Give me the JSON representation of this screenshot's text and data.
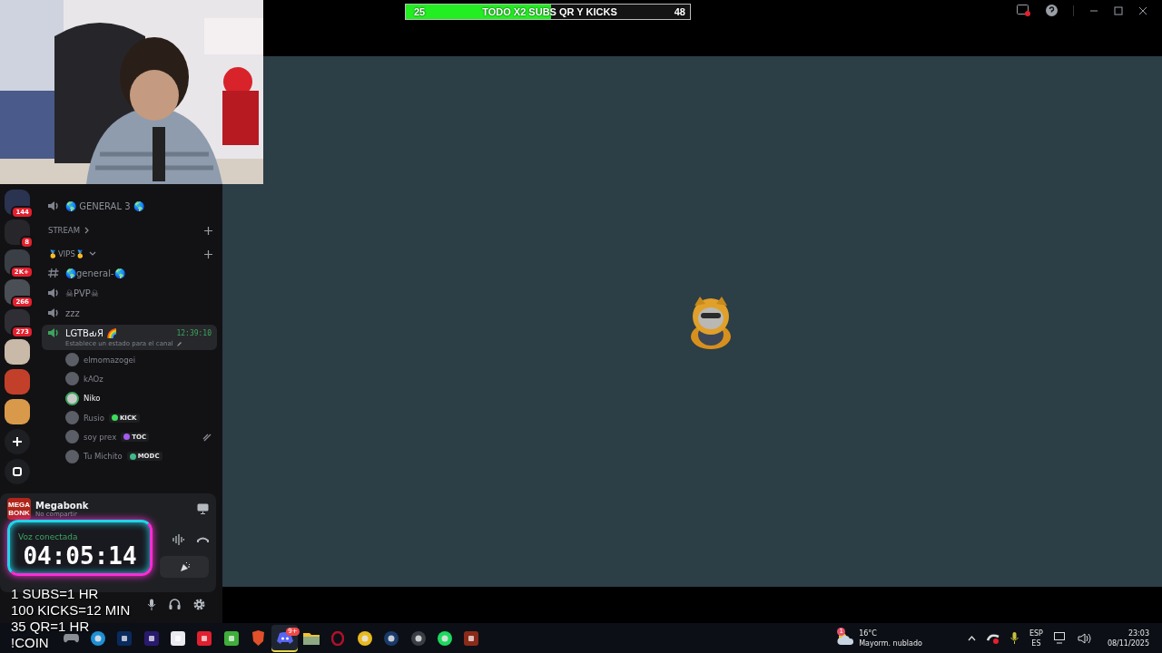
{
  "goal_bar": {
    "start": "25",
    "label": "TODO X2 SUBS QR Y KICKS",
    "end": "48",
    "level": 0.51
  },
  "servers": [
    {
      "badge": "144",
      "color": "#2a3350"
    },
    {
      "badge": "8",
      "color": "#26262b"
    },
    {
      "badge": "2K+",
      "color": "#3a3f46"
    },
    {
      "badge": "266",
      "color": "#4a4f55"
    },
    {
      "badge": "273",
      "color": "#2e2e34"
    },
    {
      "color": "#c9b9a8"
    },
    {
      "color": "#c2402a"
    },
    {
      "color": "#d89a4a"
    }
  ],
  "channels": [
    {
      "kind": "voice",
      "name": "🌎 GENERAL 3 🌎",
      "selected": false
    },
    {
      "kind": "category",
      "name": "STREAM",
      "expanded": false
    },
    {
      "kind": "category",
      "name": "🥇VIPS🥇",
      "expanded": true
    },
    {
      "kind": "text",
      "name": "🌎general-🌎",
      "selected": false
    },
    {
      "kind": "voice",
      "name": "☠PVP☠",
      "selected": false
    },
    {
      "kind": "voice",
      "name": "zzz",
      "selected": false
    },
    {
      "kind": "voice",
      "name": "LGTBԃЯ 🌈",
      "selected": true,
      "time": "12:39:10",
      "status": "Establece un estado para el canal",
      "members": [
        {
          "name": "elmomazogei",
          "speaking": false,
          "muted": false
        },
        {
          "name": "kAOz",
          "speaking": false,
          "muted": false
        },
        {
          "name": "Niko",
          "speaking": true,
          "muted": false
        },
        {
          "name": "Rusio",
          "speaking": false,
          "muted": false,
          "tag": {
            "text": "KICK",
            "color": "#3ddc5a"
          }
        },
        {
          "name": "soy prex",
          "speaking": false,
          "muted": true,
          "tag": {
            "text": "TOC",
            "color": "#a35cf0"
          }
        },
        {
          "name": "Tu Michito",
          "speaking": false,
          "muted": false,
          "tag": {
            "text": "MODC",
            "color": "#3fb98a"
          }
        }
      ]
    }
  ],
  "user_panel": {
    "logo": [
      "MEGA",
      "BONK"
    ],
    "activity": "Megabonk",
    "activity_sub": "No compartir",
    "voice_status": "Voz conectada"
  },
  "timer": "04:05:14",
  "goal_rules": [
    "1 SUBS=1 HR",
    "100 KICKS=12 MIN",
    "35 QR=1 HR",
    "!COIN"
  ],
  "taskbar": {
    "discord_badge": "9+",
    "weather_badge": "1",
    "temperature": "16°C",
    "weather": "Mayorm. nublado",
    "lang": "ESP",
    "layout": "ES",
    "time": "23:03",
    "date": "08/11/2025"
  }
}
